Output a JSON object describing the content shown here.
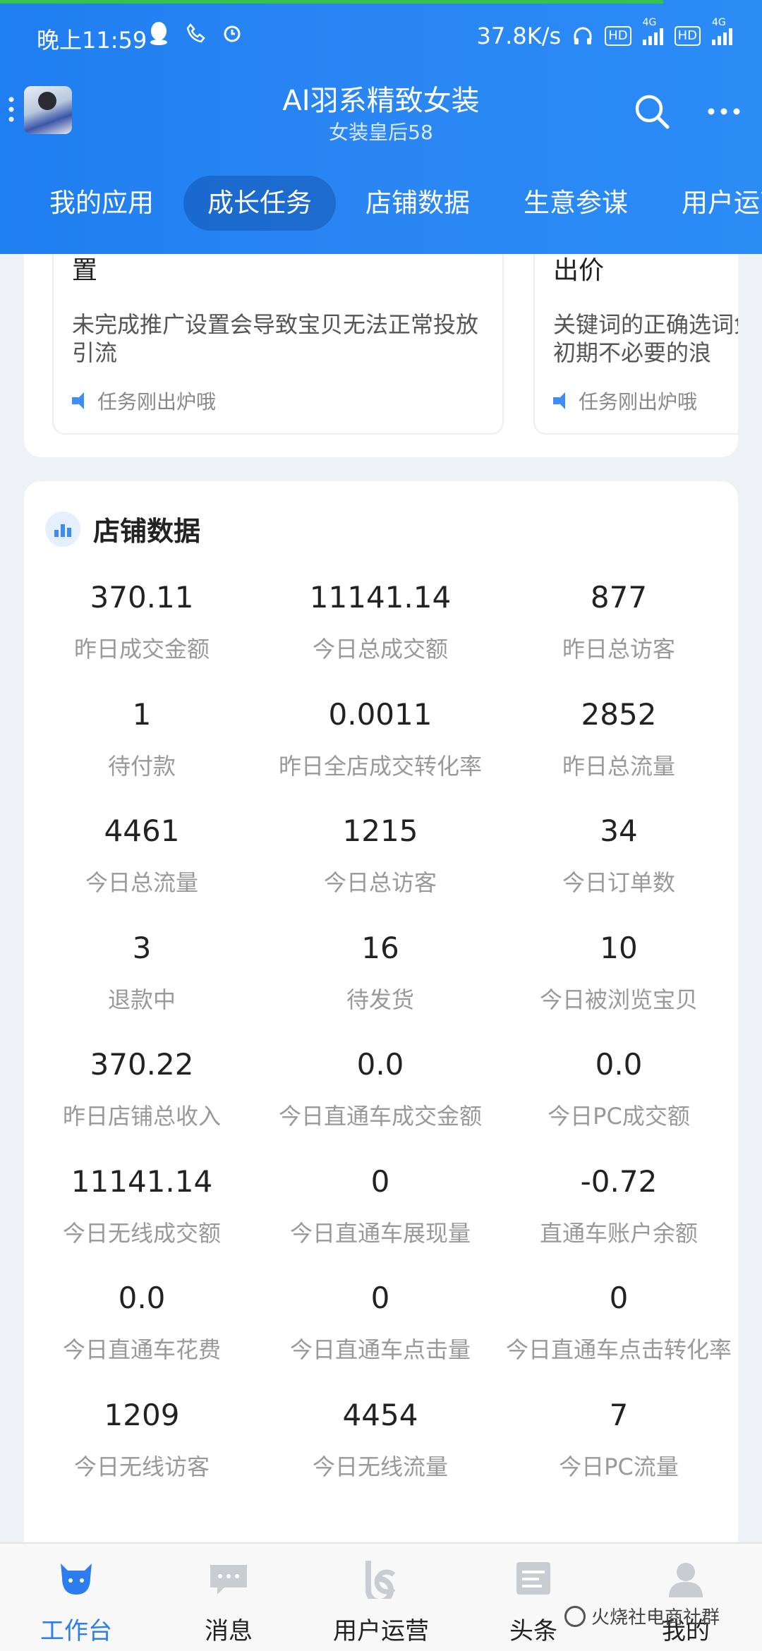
{
  "status_bar": {
    "time": "晚上11:59",
    "network_speed": "37.8K/s",
    "hd1": "HD",
    "hd2": "HD",
    "net1": "4G",
    "net2": "4G"
  },
  "header": {
    "shop_name": "AI羽系精致女装",
    "shop_subtitle": "女装皇后58",
    "tabs": [
      {
        "label": "我的应用",
        "active": false
      },
      {
        "label": "成长任务",
        "active": true
      },
      {
        "label": "店铺数据",
        "active": false
      },
      {
        "label": "生意参谋",
        "active": false
      },
      {
        "label": "用户运营",
        "active": false
      }
    ]
  },
  "tasks": [
    {
      "title_line2": "置",
      "desc": "未完成推广设置会导致宝贝无法正常投放引流",
      "hint": "任务刚出炉哦"
    },
    {
      "title_line2": "出价",
      "desc": "关键词的正确选词免初期不必要的浪",
      "hint": "任务刚出炉哦"
    }
  ],
  "store_data": {
    "title": "店铺数据",
    "metrics": [
      {
        "value": "370.11",
        "label": "昨日成交金额"
      },
      {
        "value": "11141.14",
        "label": "今日总成交额"
      },
      {
        "value": "877",
        "label": "昨日总访客"
      },
      {
        "value": "1",
        "label": "待付款"
      },
      {
        "value": "0.0011",
        "label": "昨日全店成交转化率"
      },
      {
        "value": "2852",
        "label": "昨日总流量"
      },
      {
        "value": "4461",
        "label": "今日总流量"
      },
      {
        "value": "1215",
        "label": "今日总访客"
      },
      {
        "value": "34",
        "label": "今日订单数"
      },
      {
        "value": "3",
        "label": "退款中"
      },
      {
        "value": "16",
        "label": "待发货"
      },
      {
        "value": "10",
        "label": "今日被浏览宝贝"
      },
      {
        "value": "370.22",
        "label": "昨日店铺总收入"
      },
      {
        "value": "0.0",
        "label": "今日直通车成交金额"
      },
      {
        "value": "0.0",
        "label": "今日PC成交额"
      },
      {
        "value": "11141.14",
        "label": "今日无线成交额"
      },
      {
        "value": "0",
        "label": "今日直通车展现量"
      },
      {
        "value": "-0.72",
        "label": "直通车账户余额"
      },
      {
        "value": "0.0",
        "label": "今日直通车花费"
      },
      {
        "value": "0",
        "label": "今日直通车点击量"
      },
      {
        "value": "0",
        "label": "今日直通车点击转化率"
      },
      {
        "value": "1209",
        "label": "今日无线访客"
      },
      {
        "value": "4454",
        "label": "今日无线流量"
      },
      {
        "value": "7",
        "label": "今日PC流量"
      }
    ]
  },
  "bottom_nav": [
    {
      "label": "工作台",
      "icon": "cow-icon",
      "active": true
    },
    {
      "label": "消息",
      "icon": "chat-bubble-icon",
      "active": false
    },
    {
      "label": "用户运营",
      "icon": "user-ops-icon",
      "active": false
    },
    {
      "label": "头条",
      "icon": "news-icon",
      "active": false
    },
    {
      "label": "我的",
      "icon": "person-icon",
      "active": false
    }
  ],
  "watermark": "火烧社电商社群",
  "colors": {
    "header_blue": "#2a86f3",
    "active_nav": "#2c7df0",
    "label_gray": "#999999",
    "background": "#eef1f6"
  }
}
